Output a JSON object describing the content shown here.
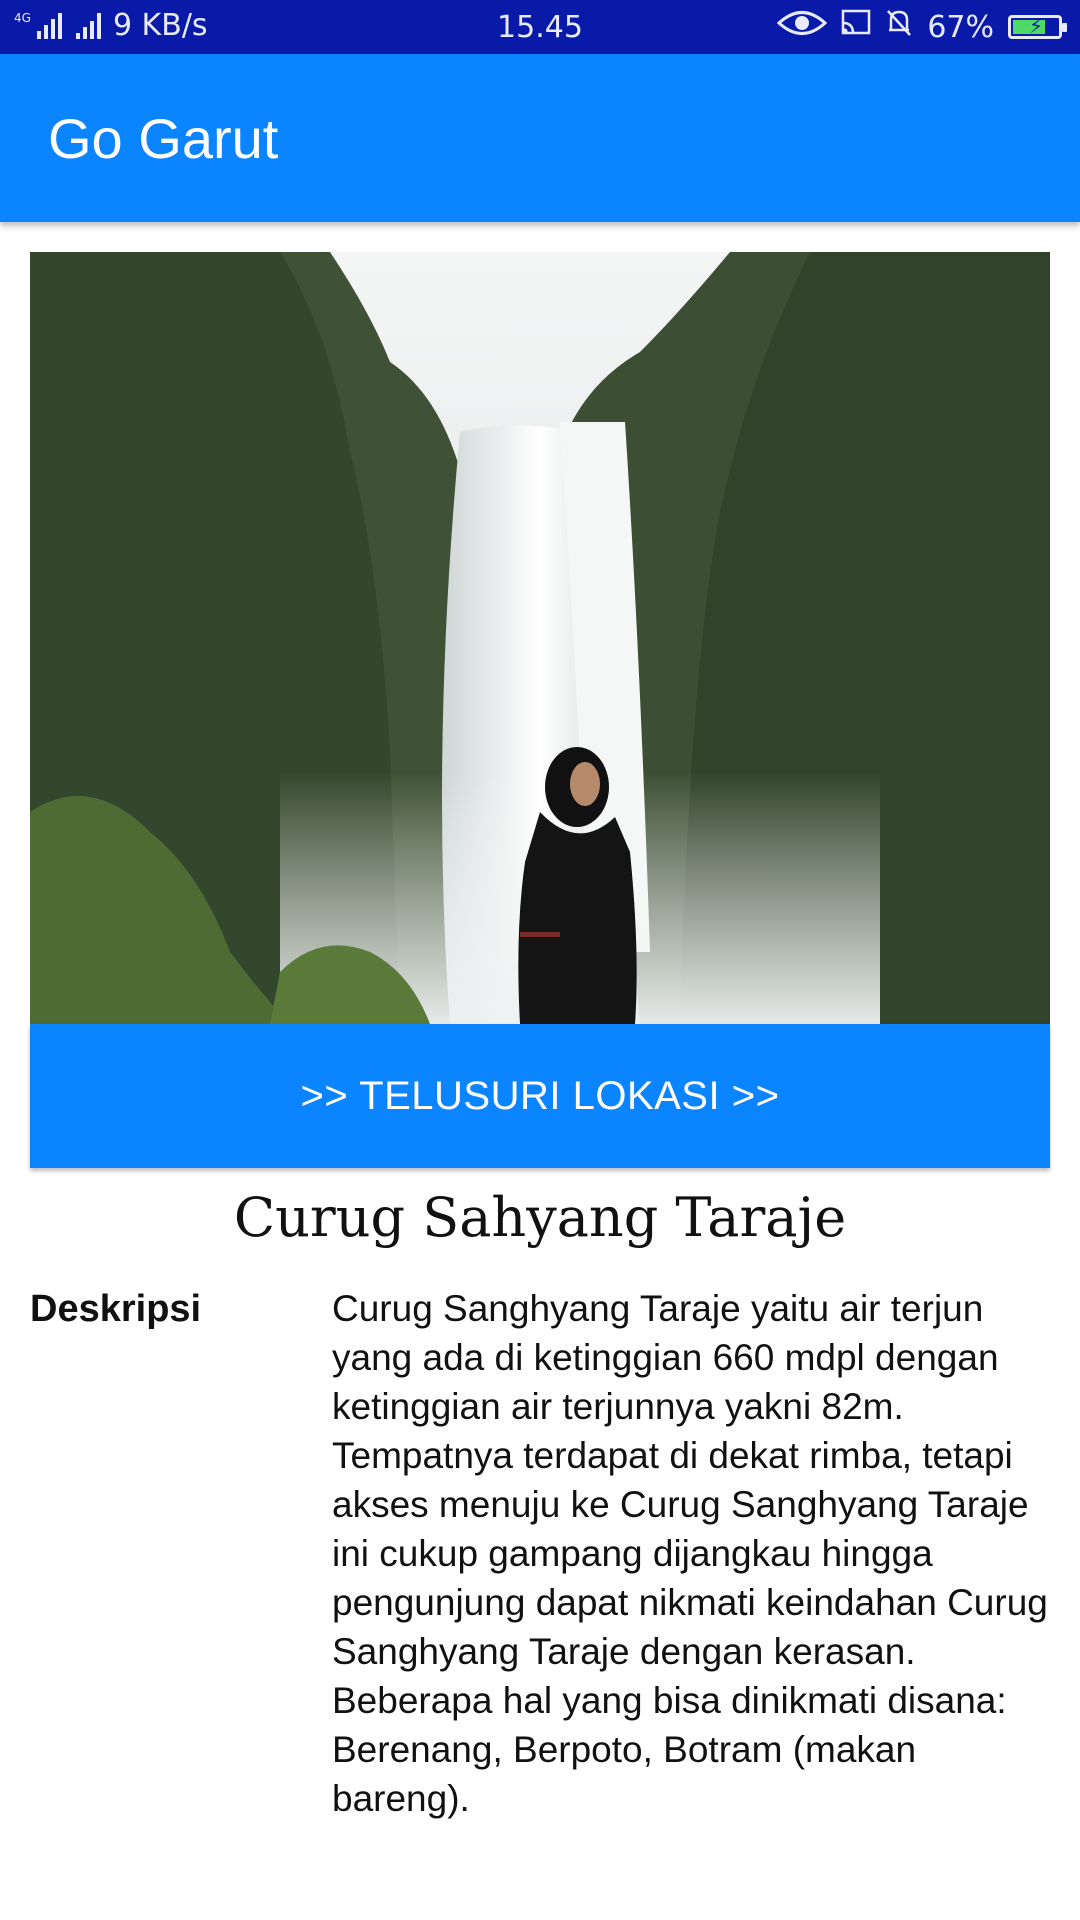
{
  "status_bar": {
    "network_label": "4G",
    "speed": "9 KB/s",
    "time": "15.45",
    "battery": "67%",
    "battery_level": 0.67
  },
  "appbar": {
    "title": "Go Garut"
  },
  "hero": {
    "button_label": ">> TELUSURI LOKASI >>"
  },
  "place": {
    "title": "Curug Sahyang Taraje",
    "description_label": "Deskripsi",
    "description": "Curug Sanghyang Taraje yaitu air terjun yang ada di ketinggian 660 mdpl dengan ketinggian air terjunnya yakni 82m. Tempatnya terdapat di dekat rimba, tetapi akses menuju ke Curug Sanghyang Taraje ini cukup gampang dijangkau hingga pengunjung dapat nikmati keindahan Curug Sanghyang Taraje dengan kerasan. Beberapa hal yang bisa dinikmati disana: Berenang, Berpoto, Botram (makan bareng)."
  },
  "colors": {
    "statusbar": "#0a1aa8",
    "primary": "#0a84ff"
  }
}
